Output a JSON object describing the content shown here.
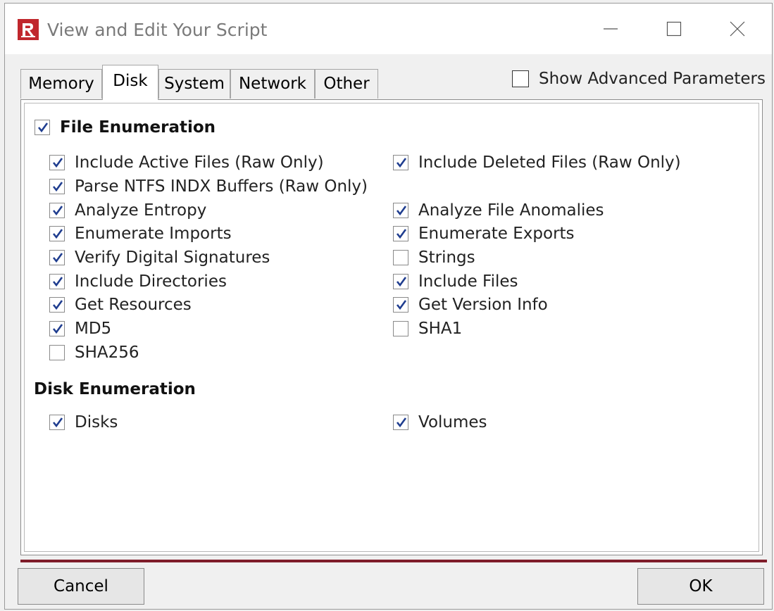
{
  "window": {
    "title": "View and Edit Your Script"
  },
  "tabs": [
    {
      "label": "Memory",
      "active": false
    },
    {
      "label": "Disk",
      "active": true
    },
    {
      "label": "System",
      "active": false
    },
    {
      "label": "Network",
      "active": false
    },
    {
      "label": "Other",
      "active": false
    }
  ],
  "advanced": {
    "label": "Show Advanced Parameters",
    "checked": false
  },
  "file_enumeration": {
    "label": "File Enumeration",
    "checked": true,
    "options": [
      {
        "label": "Include Active Files (Raw Only)",
        "checked": true
      },
      {
        "label": "Include Deleted Files (Raw Only)",
        "checked": true
      },
      {
        "label": "Parse NTFS INDX Buffers (Raw Only)",
        "checked": true
      },
      {
        "label": "Analyze Entropy",
        "checked": true
      },
      {
        "label": "Analyze File Anomalies",
        "checked": true
      },
      {
        "label": "Enumerate Imports",
        "checked": true
      },
      {
        "label": "Enumerate Exports",
        "checked": true
      },
      {
        "label": "Verify Digital Signatures",
        "checked": true
      },
      {
        "label": "Strings",
        "checked": false
      },
      {
        "label": "Include Directories",
        "checked": true
      },
      {
        "label": "Include Files",
        "checked": true
      },
      {
        "label": "Get Resources",
        "checked": true
      },
      {
        "label": "Get Version Info",
        "checked": true
      },
      {
        "label": "MD5",
        "checked": true
      },
      {
        "label": "SHA1",
        "checked": false
      },
      {
        "label": "SHA256",
        "checked": false
      }
    ]
  },
  "disk_enumeration": {
    "label": "Disk Enumeration",
    "options": [
      {
        "label": "Disks",
        "checked": true
      },
      {
        "label": "Volumes",
        "checked": true
      }
    ]
  },
  "buttons": {
    "cancel": "Cancel",
    "ok": "OK"
  },
  "colors": {
    "accent": "#7f1d2a",
    "app_icon": "#c0272d",
    "check": "#1f3d8f"
  },
  "icons": {
    "app": "rapid-r-logo-icon",
    "minimize": "minimize-icon",
    "maximize": "maximize-icon",
    "close": "close-icon",
    "check": "checkmark-icon"
  }
}
